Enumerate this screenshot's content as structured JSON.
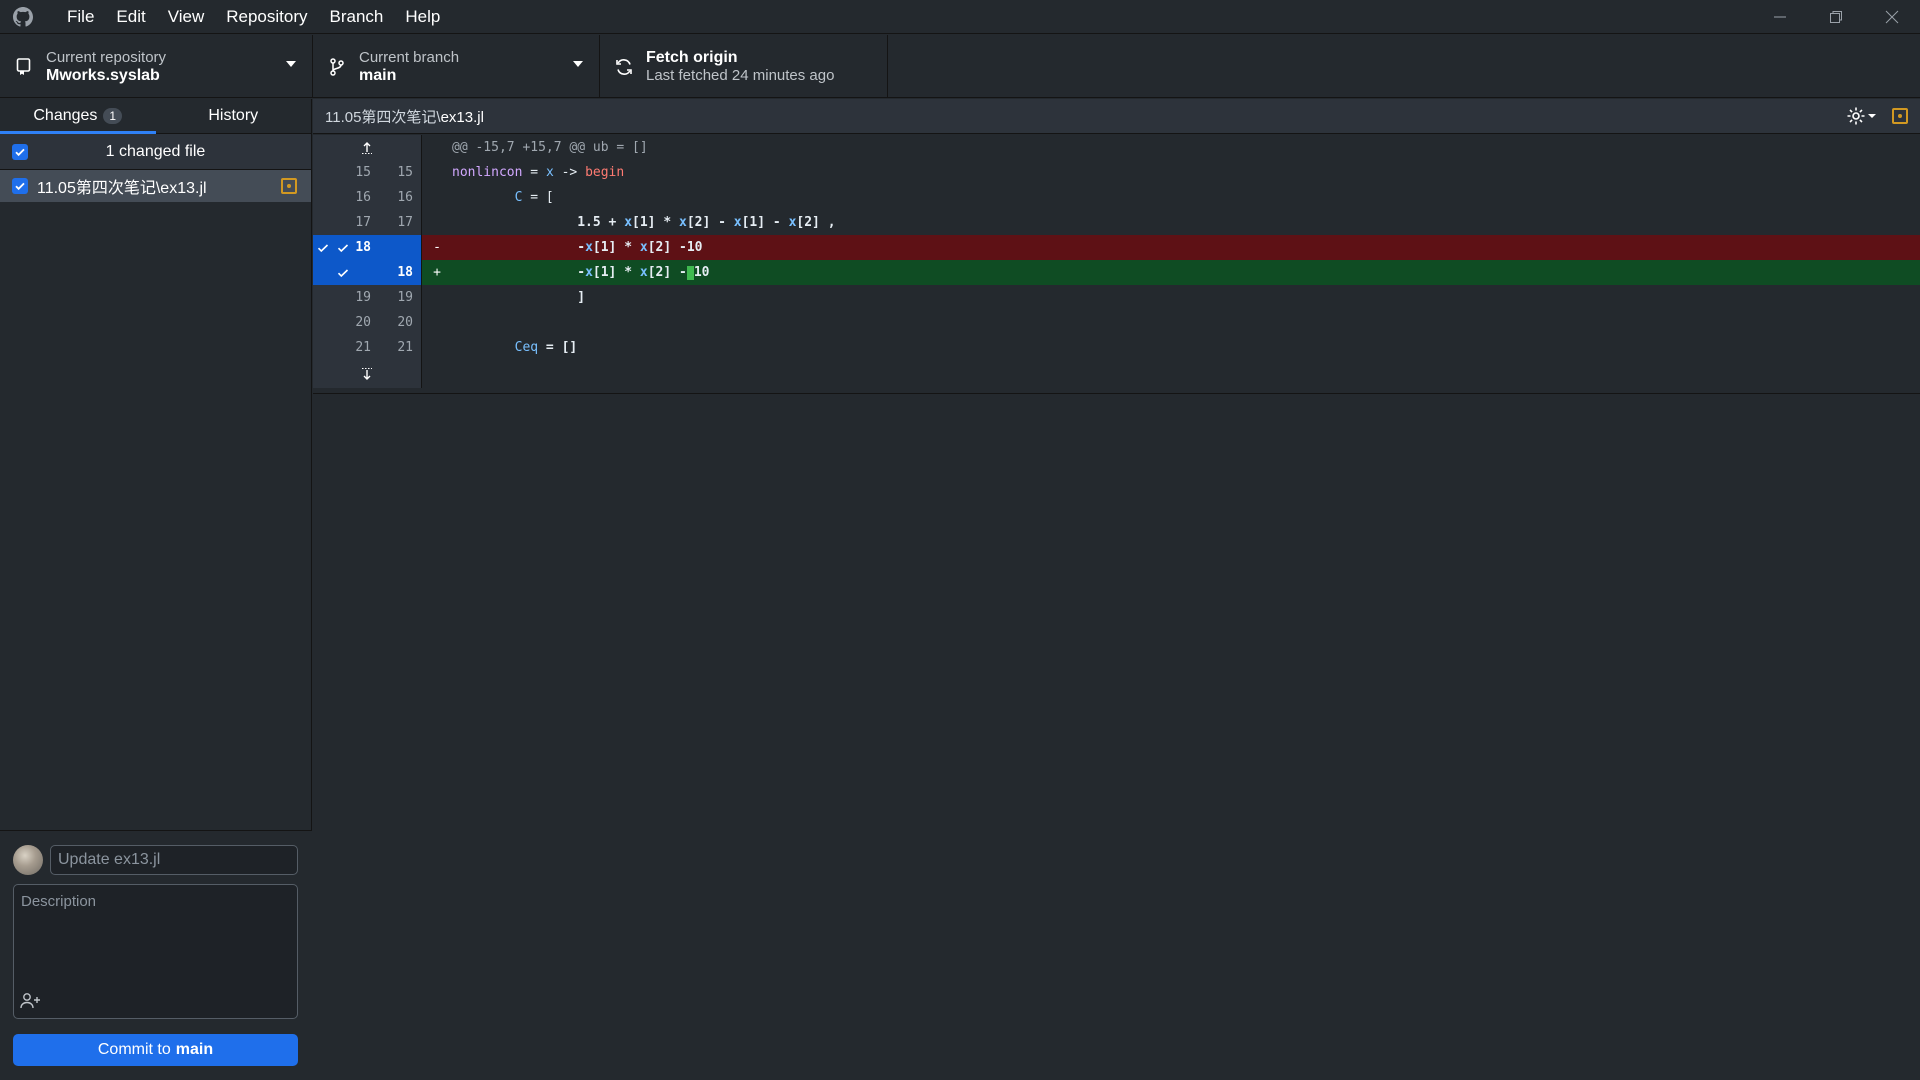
{
  "menu": {
    "items": [
      "File",
      "Edit",
      "View",
      "Repository",
      "Branch",
      "Help"
    ]
  },
  "toolbar": {
    "repo_label": "Current repository",
    "repo_name": "Mworks.syslab",
    "branch_label": "Current branch",
    "branch_name": "main",
    "fetch_label": "Fetch origin",
    "fetch_status": "Last fetched 24 minutes ago"
  },
  "sidebar": {
    "tabs": {
      "changes": "Changes",
      "changes_count": "1",
      "history": "History"
    },
    "changed_header": "1 changed file",
    "files": [
      {
        "name": "11.05第四次笔记\\ex13.jl"
      }
    ]
  },
  "commit": {
    "summary_placeholder": "Update ex13.jl",
    "description_placeholder": "Description",
    "button_prefix": "Commit to",
    "button_branch": "main"
  },
  "diff": {
    "path_prefix": "11.05第四次笔记\\",
    "path_file": "ex13.jl",
    "hunk_header": "@@ -15,7 +15,7 @@ ub = []",
    "lines": [
      {
        "old": "15",
        "new": "15",
        "sign": "",
        "type": "ctx"
      },
      {
        "old": "16",
        "new": "16",
        "sign": "",
        "type": "ctx"
      },
      {
        "old": "17",
        "new": "17",
        "sign": "",
        "type": "ctx"
      },
      {
        "old": "18",
        "new": "",
        "sign": "-",
        "type": "del"
      },
      {
        "old": "",
        "new": "18",
        "sign": "+",
        "type": "add"
      },
      {
        "old": "19",
        "new": "19",
        "sign": "",
        "type": "ctx"
      },
      {
        "old": "20",
        "new": "20",
        "sign": "",
        "type": "ctx"
      },
      {
        "old": "21",
        "new": "21",
        "sign": "",
        "type": "ctx"
      }
    ],
    "code": {
      "l15_a": "nonlincon",
      "l15_b": " = ",
      "l15_c": "x",
      "l15_d": " -> ",
      "l15_e": "begin",
      "l16_a": "        C",
      "l16_b": " = [",
      "l17_a": "                1.5 + ",
      "l17_b": "x",
      "l17_c": "[1] * ",
      "l17_d": "x",
      "l17_e": "[2] - ",
      "l17_f": "x",
      "l17_g": "[1] - ",
      "l17_h": "x",
      "l17_i": "[2] ,",
      "l18d_a": "                -",
      "l18d_b": "x",
      "l18d_c": "[1] * ",
      "l18d_d": "x",
      "l18d_e": "[2] -10",
      "l18a_a": "                -",
      "l18a_b": "x",
      "l18a_c": "[1] * ",
      "l18a_d": "x",
      "l18a_e": "[2] -",
      "l18a_f": "10",
      "l19_a": "                ]",
      "l20_a": "",
      "l21_a": "        Ceq",
      "l21_b": " = []"
    }
  },
  "colors": {
    "accent": "#1f6feb",
    "deleted_bg": "#5e1115",
    "added_bg": "#0f4c23",
    "modified": "#d29922"
  }
}
